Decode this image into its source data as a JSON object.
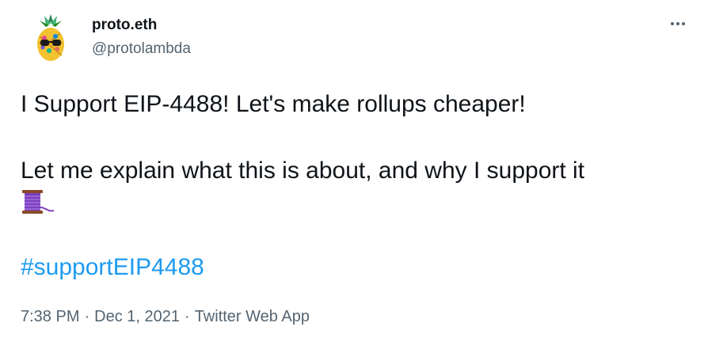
{
  "author": {
    "display_name": "proto.eth",
    "handle": "@protolambda"
  },
  "tweet": {
    "line1": "I Support EIP-4488! Let's make rollups cheaper!",
    "line2": "Let me explain what this is about, and why I support it",
    "thread_emoji_icon": "thread-spool-icon",
    "hashtag": "#supportEIP4488"
  },
  "meta": {
    "time": "7:38 PM",
    "date": "Dec 1, 2021",
    "separator": "·",
    "source": "Twitter Web App"
  },
  "colors": {
    "text": "#0f1419",
    "secondary": "#536471",
    "link": "#1d9bf0"
  }
}
